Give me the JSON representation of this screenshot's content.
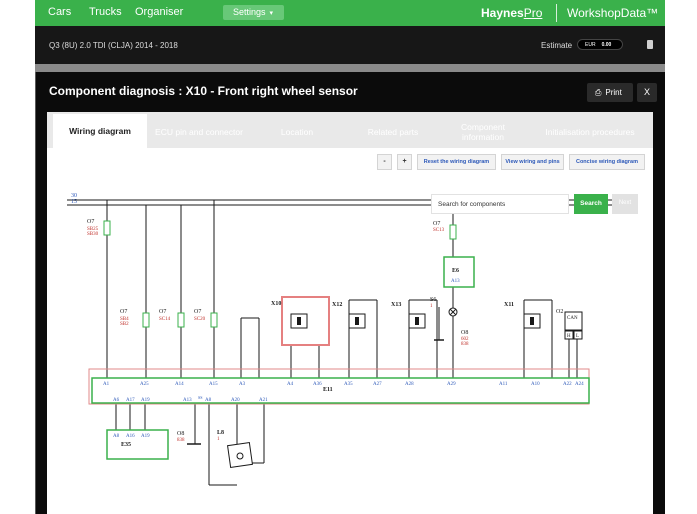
{
  "topnav": {
    "items": [
      "Cars",
      "Trucks",
      "Organiser"
    ],
    "settings_label": "Settings",
    "brand_main": "Haynes",
    "brand_pro": "Pro",
    "product_name": "WorkshopData™"
  },
  "vehicle": {
    "name": "Q3 (8U) 2.0 TDI (CLJA) 2014 - 2018",
    "estimate_label": "Estimate",
    "currency": "EUR",
    "amount": "0.00"
  },
  "modal": {
    "title": "Component diagnosis : X10 - Front right wheel sensor",
    "print_label": "Print",
    "close_label": "X"
  },
  "tabs": [
    "Wiring diagram",
    "ECU pin and connector",
    "Location",
    "Related parts",
    "Component information",
    "Initialisation procedures"
  ],
  "toolbar": {
    "zoom_out": "-",
    "zoom_in": "+",
    "reset_label": "Reset the wiring diagram",
    "view_pins_label": "View wiring and pins",
    "concise_label": "Concise wiring diagram"
  },
  "diagram_search": {
    "placeholder": "Search for components",
    "search_label": "Search",
    "next_label": "Next"
  },
  "wiring": {
    "bus_30": "30",
    "bus_15": "15",
    "fuse_a_name": "O7",
    "fuse_a_codes": [
      "SB25",
      "SB30"
    ],
    "fuse_b_name": "O7",
    "fuse_b_codes": [
      "SB4",
      "SB2"
    ],
    "fuse_c_name": "O7",
    "fuse_c_code": "SC14",
    "fuse_d_name": "O7",
    "fuse_d_code": "SC20",
    "fuse_e_name": "O7",
    "fuse_e_code": "SC13",
    "e6_name": "E6",
    "e6_pin": "A13",
    "s6_name": "S6",
    "s6_num": "1",
    "o8_top_name": "O8",
    "o8_top_codes": [
      "602",
      "838"
    ],
    "sensor_x10": "X10",
    "sensor_x12": "X12",
    "sensor_x13": "X13",
    "sensor_x11": "X11",
    "o2_name": "O2",
    "can_label": "CAN",
    "can_pins": [
      "H",
      "L"
    ],
    "e11_name": "E11",
    "e11_top_pins": [
      "A1",
      "A25",
      "A14",
      "A15",
      "A3",
      "A4",
      "A36",
      "A35",
      "A27",
      "A28",
      "A29",
      "A11",
      "A10",
      "A22",
      "A24"
    ],
    "e11_bottom_pins": [
      "A6",
      "A17",
      "A19",
      "A13",
      "A8",
      "A20",
      "A21"
    ],
    "e35_name": "E35",
    "e35_pins": [
      "A8",
      "A16",
      "A19"
    ],
    "o8_bottom_name": "O8",
    "o8_bottom_code": "838",
    "l8_name": "L8",
    "l8_num": "1",
    "shield_label": "SS"
  }
}
